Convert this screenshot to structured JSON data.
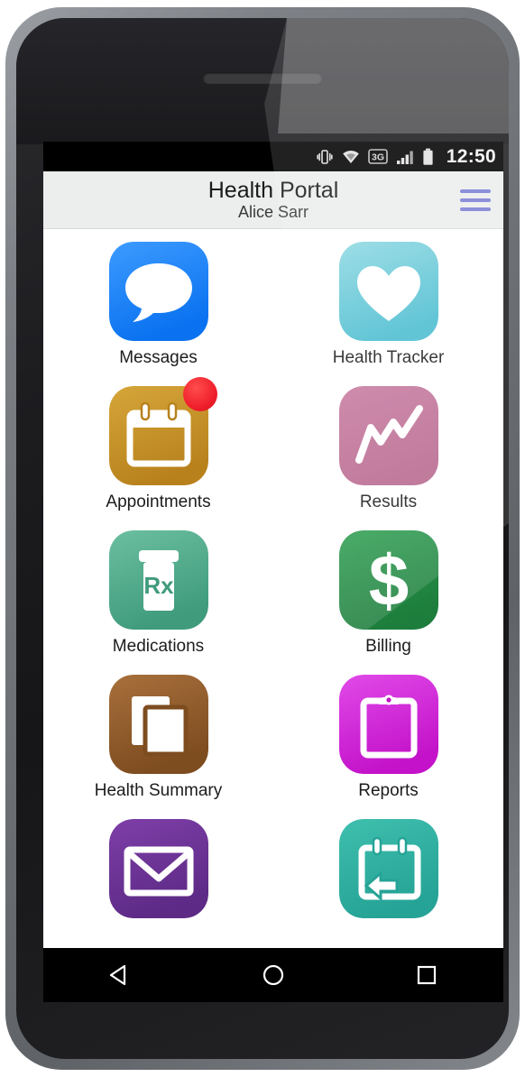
{
  "device": {
    "name": "smartphone-mockup",
    "earpiece": "speaker-grille"
  },
  "status_bar": {
    "clock": "12:50",
    "network_label": "3G",
    "icons": [
      "vibrate-icon",
      "wifi-icon",
      "network-3g-icon",
      "signal-bars-icon",
      "battery-icon"
    ],
    "background": "#000000",
    "foreground": "#e8e8e8"
  },
  "header": {
    "title": "Health Portal",
    "subtitle": "Alice Sarr",
    "menu_icon": "hamburger-menu-icon",
    "menu_color": "#7b7fd4",
    "background": "#eceded"
  },
  "apps": [
    {
      "label": "Messages",
      "icon": "speech-bubble-icon",
      "color_start": "#3d9bff",
      "color_end": "#0a72f0",
      "badge": null
    },
    {
      "label": "Health Tracker",
      "icon": "heart-icon",
      "color_start": "#8fd9e3",
      "color_end": "#4bbdd0",
      "badge": null
    },
    {
      "label": "Appointments",
      "icon": "calendar-icon",
      "color_start": "#d6a63a",
      "color_end": "#b8811c",
      "badge": "notification-dot"
    },
    {
      "label": "Results",
      "icon": "line-chart-icon",
      "color_start": "#c87ba0",
      "color_end": "#b8688f",
      "badge": null
    },
    {
      "label": "Medications",
      "icon": "rx-bottle-icon",
      "color_start": "#6bbfa0",
      "color_end": "#3f9b7c",
      "badge": null
    },
    {
      "label": "Billing",
      "icon": "dollar-sign-icon",
      "color_start": "#2f9f52",
      "color_end": "#1d7d3c",
      "badge": null
    },
    {
      "label": "Health Summary",
      "icon": "documents-icon",
      "color_start": "#a8703c",
      "color_end": "#7d4c1f",
      "badge": null
    },
    {
      "label": "Reports",
      "icon": "clipboard-icon",
      "color_start": "#e04ae8",
      "color_end": "#c312c9",
      "badge": null
    },
    {
      "label": "",
      "icon": "envelope-icon",
      "color_start": "#7e3fa8",
      "color_end": "#5d2a86",
      "badge": null
    },
    {
      "label": "",
      "icon": "calendar-reschedule-icon",
      "color_start": "#3fbfae",
      "color_end": "#25a396",
      "badge": null
    }
  ],
  "nav_bar": {
    "background": "#000000",
    "buttons": [
      {
        "name": "back-button",
        "icon": "triangle-left-icon"
      },
      {
        "name": "home-button",
        "icon": "circle-icon"
      },
      {
        "name": "recents-button",
        "icon": "square-icon"
      }
    ]
  }
}
